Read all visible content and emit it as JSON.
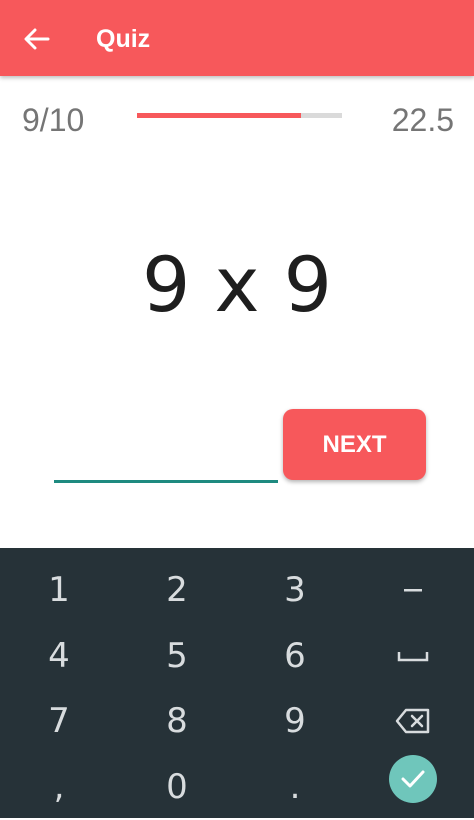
{
  "appbar": {
    "title": "Quiz",
    "back_icon": "arrow-back-icon",
    "color": "#f7585b"
  },
  "progress": {
    "count": "9/10",
    "fraction": 0.8,
    "score": "22.5"
  },
  "question": {
    "text": "9 x 9"
  },
  "answer": {
    "value": "",
    "placeholder": ""
  },
  "next_button": {
    "label": "NEXT"
  },
  "keyboard": {
    "background": "#263238",
    "keys": [
      "1",
      "2",
      "3",
      "−",
      "4",
      "5",
      "6",
      "␣",
      "7",
      "8",
      "9",
      "⌫",
      ",",
      "0",
      ".",
      "✓"
    ],
    "icons": {
      "space": "space-bar-icon",
      "backspace": "backspace-icon",
      "done": "checkmark-icon"
    }
  }
}
